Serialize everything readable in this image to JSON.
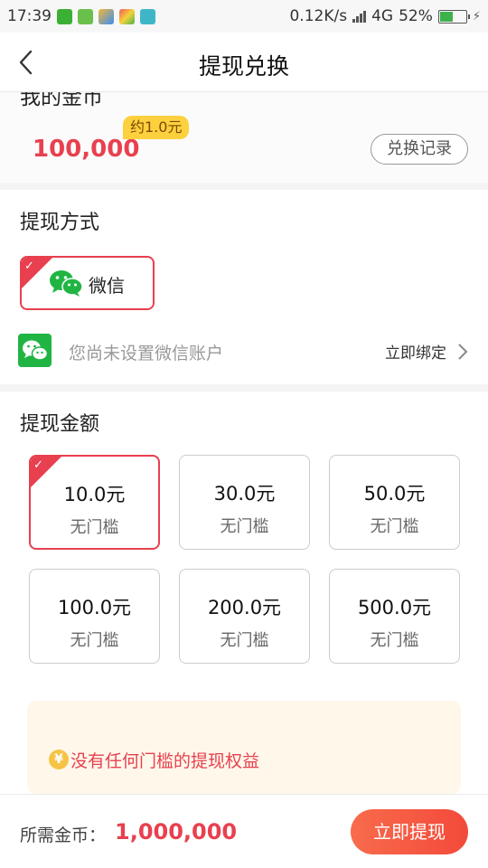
{
  "status_bar": {
    "time": "17:39",
    "network_speed": "0.12K/s",
    "network_type": "4G",
    "battery_percent": "52%",
    "battery_level": 0.52,
    "notification_icons": [
      "wechat-icon",
      "refresh-app-icon",
      "gallery-app-icon",
      "tool-app-icon",
      "scan-app-icon"
    ]
  },
  "header": {
    "title": "提现兑换"
  },
  "coins": {
    "label": "我的金币",
    "value": "100,000",
    "approx": "约1.0元",
    "history_button": "兑换记录"
  },
  "method": {
    "title": "提现方式",
    "selected_option": "微信",
    "account_hint": "您尚未设置微信账户",
    "bind_link": "立即绑定"
  },
  "amount": {
    "title": "提现金额",
    "options": [
      {
        "amount": "10.0元",
        "note": "无门槛",
        "selected": true
      },
      {
        "amount": "30.0元",
        "note": "无门槛",
        "selected": false
      },
      {
        "amount": "50.0元",
        "note": "无门槛",
        "selected": false
      },
      {
        "amount": "100.0元",
        "note": "无门槛",
        "selected": false
      },
      {
        "amount": "200.0元",
        "note": "无门槛",
        "selected": false
      },
      {
        "amount": "500.0元",
        "note": "无门槛",
        "selected": false
      }
    ],
    "tip_icon": "¥",
    "tip_text": "没有任何门槛的提现权益"
  },
  "bottom": {
    "required_label": "所需金币：",
    "required_value": "1,000,000",
    "withdraw_button": "立即提现"
  },
  "colors": {
    "accent": "#e8404f",
    "wechat_green": "#20b543",
    "badge_yellow": "#fcd13d",
    "button_orange": "#f5573f"
  }
}
